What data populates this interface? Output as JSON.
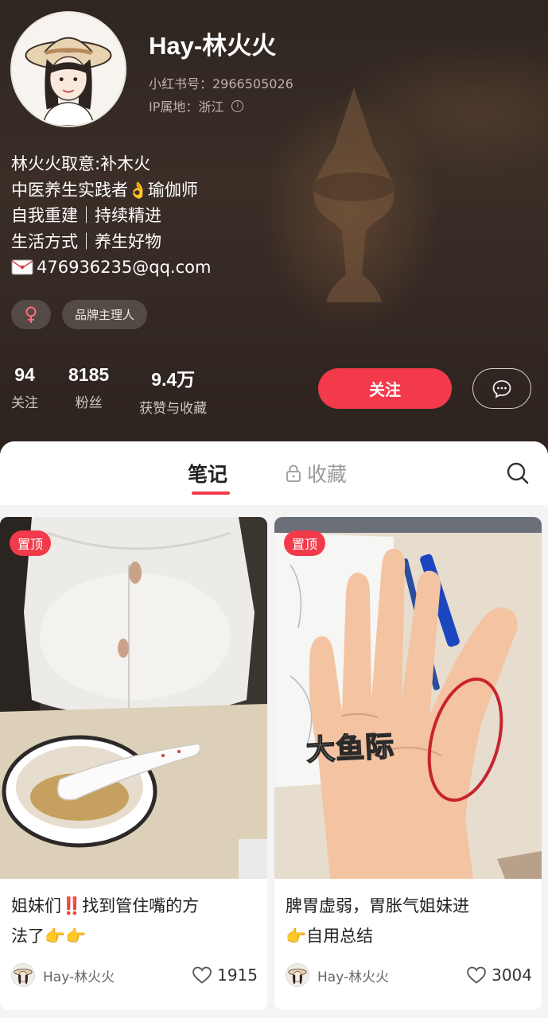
{
  "profile": {
    "username": "Hay-林火火",
    "xhs_id": "小红书号：2966505026",
    "ip_location": "IP属地：浙江",
    "bio": [
      "林火火取意:补木火",
      "中医养生实践者",
      "瑜伽师",
      "自我重建｜持续精进",
      "生活方式｜养生好物",
      "476936235@qq.com"
    ],
    "bio_emoji": "💰",
    "tags": {
      "gender_symbol": "♀",
      "role": "品牌主理人"
    },
    "stats": [
      {
        "value": "94",
        "label": "关注"
      },
      {
        "value": "8185",
        "label": "粉丝"
      },
      {
        "value": "9.4万",
        "label": "获赞与收藏"
      }
    ],
    "follow_label": "关注"
  },
  "tabs": {
    "notes": "笔记",
    "collections": "收藏"
  },
  "notes": [
    {
      "badge": "置顶",
      "title_line1": "姐妹们‼️找到管住嘴的方",
      "title_line2": "法了👉👉",
      "author": "Hay-林火火",
      "likes": "1915"
    },
    {
      "badge": "置顶",
      "overlay": "大鱼际",
      "title_line1": "脾胃虚弱，胃胀气姐妹进",
      "title_line2": "👉自用总结",
      "author": "Hay-林火火",
      "likes": "3004"
    }
  ],
  "colors": {
    "accent": "#f23a4a",
    "header_bg": "#332823"
  },
  "icons": [
    "info-icon",
    "mail-icon",
    "female-icon",
    "chat-bubble-icon",
    "lock-icon",
    "search-icon",
    "heart-icon"
  ]
}
